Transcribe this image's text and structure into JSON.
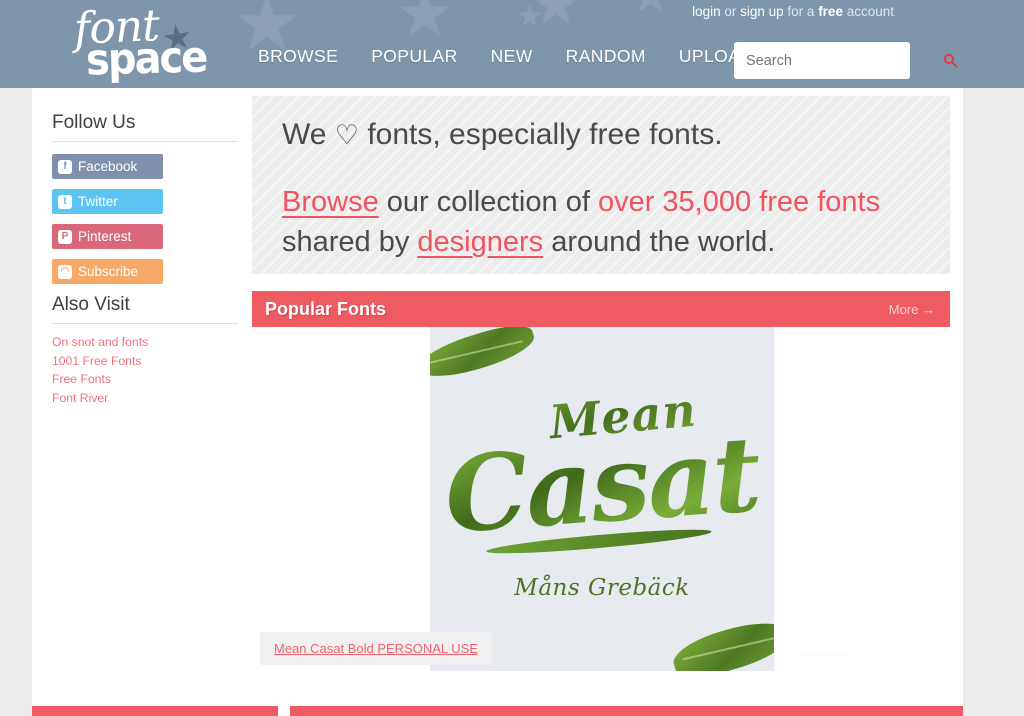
{
  "header": {
    "logo": {
      "line1": "font",
      "line2": "space",
      "star": "★"
    },
    "account": {
      "login": "login",
      "or": " or ",
      "signup": "sign up",
      "mid": " for a ",
      "free": "free",
      "tail": " account"
    },
    "nav": [
      {
        "label": "BROWSE"
      },
      {
        "label": "POPULAR"
      },
      {
        "label": "NEW"
      },
      {
        "label": "RANDOM"
      },
      {
        "label": "UPLOAD"
      }
    ],
    "search": {
      "placeholder": "Search",
      "value": ""
    },
    "colors": {
      "background": "#7e96ab",
      "star": "#8ba0b3",
      "search_icon": "#e8323f"
    }
  },
  "sidebar": {
    "follow_title": "Follow Us",
    "social": [
      {
        "label": "Facebook",
        "icon": "facebook-icon",
        "glyph": "f",
        "color": "#8290b0",
        "icon_color": "#8290b0"
      },
      {
        "label": "Twitter",
        "icon": "twitter-icon",
        "glyph": "t",
        "color": "#5bc4f0",
        "icon_color": "#5bc4f0"
      },
      {
        "label": "Pinterest",
        "icon": "pinterest-icon",
        "glyph": "P",
        "color": "#d9687a",
        "icon_color": "#d9687a"
      },
      {
        "label": "Subscribe",
        "icon": "rss-icon",
        "glyph": "◠",
        "color": "#f7a968",
        "icon_color": "#f7a968"
      }
    ],
    "also_visit_title": "Also Visit",
    "links": [
      {
        "label": "On snot and fonts"
      },
      {
        "label": "1001 Free Fonts"
      },
      {
        "label": "Free Fonts"
      },
      {
        "label": "Font River"
      }
    ],
    "link_color": "#f2707f"
  },
  "hero": {
    "line1_a": "We ",
    "heart": "♡",
    "line1_b": " fonts, especially free fonts.",
    "line2_browse": "Browse",
    "line2_a": " our collection of ",
    "line2_hl": "over 35,000 free fonts",
    "line2_b": "shared by ",
    "line2_designers": "designers",
    "line2_c": " around the world.",
    "accent": "#f2535f"
  },
  "popular": {
    "title": "Popular Fonts",
    "more": "More →",
    "bar_color": "#ef5b62"
  },
  "font_card": {
    "preview_title_top": "Mean",
    "preview_title_main": "Casat",
    "preview_author": "Måns Grebäck",
    "name": "Mean Casat Bold PERSONAL USE",
    "faint_label": "▫▫▫▫▫▫▫▫▫",
    "name_color": "#f2626f"
  }
}
